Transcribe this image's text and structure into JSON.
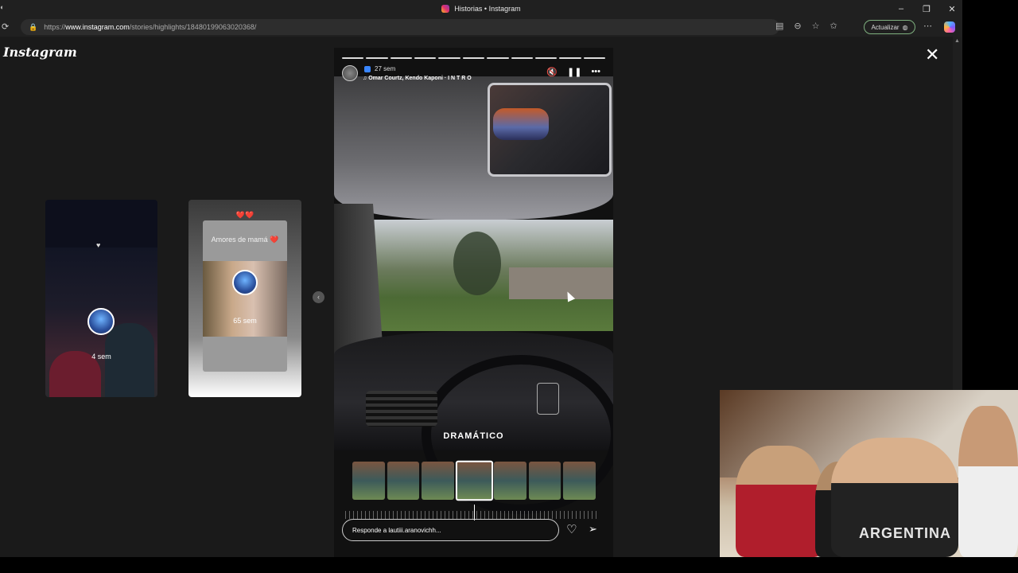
{
  "browser": {
    "tab_title": "Historias • Instagram",
    "url_prefix": "https://",
    "url_host": "www.instagram.com",
    "url_path": "/stories/highlights/18480199063020368/",
    "update_button": "Actualizar",
    "window_controls": [
      "–",
      "❐",
      "✕"
    ]
  },
  "page": {
    "logo": "Instagram",
    "close": "✕"
  },
  "previews": [
    {
      "time": "4 sem"
    },
    {
      "hearts": "❤️❤️",
      "title": "Amores de mamá ❤️",
      "time": "65 sem"
    }
  ],
  "story": {
    "time": "27 sem",
    "music": "Omar Courtz, Kendo Kaponi · I N T R O",
    "filter_label": "DRAMÁTICO",
    "reply_placeholder": "Responde a lautiii.aranovichh...",
    "progress_segments": 11,
    "progress_filled": 11
  },
  "webcam": {
    "jersey_text": "ARGENTINA"
  }
}
